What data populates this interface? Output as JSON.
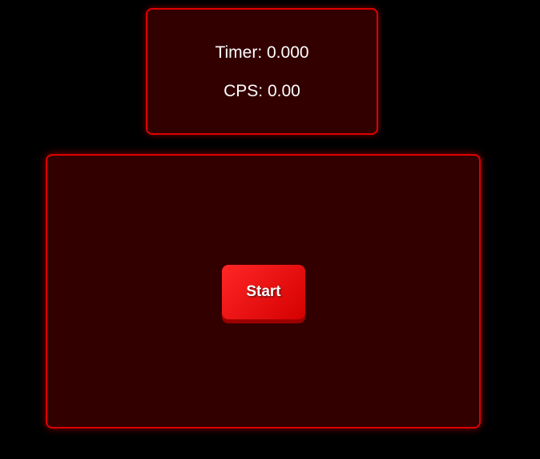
{
  "stats": {
    "timer_label": "Timer:",
    "timer_value": "0.000",
    "cps_label": "CPS:",
    "cps_value": "0.00"
  },
  "click_area": {
    "start_label": "Start"
  },
  "colors": {
    "background": "#000000",
    "panel_fill": "#330000",
    "panel_border": "#e00000",
    "button": "#e80a0a",
    "text": "#ffffff"
  }
}
